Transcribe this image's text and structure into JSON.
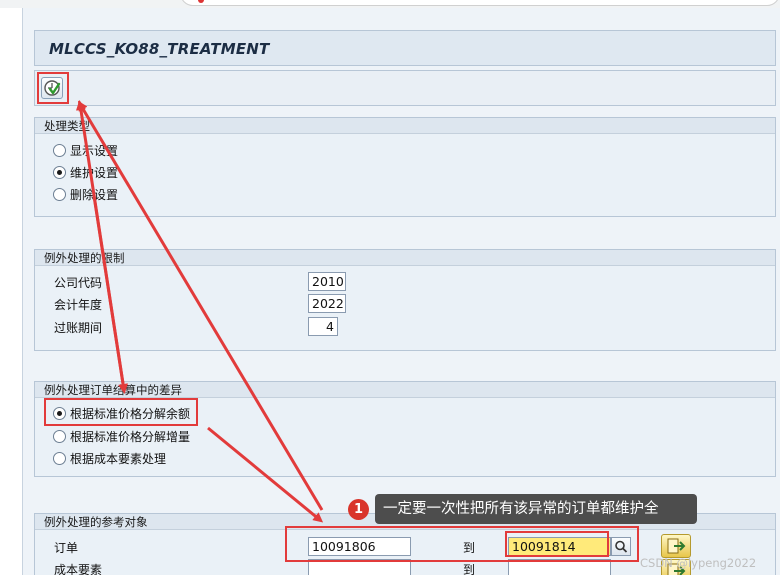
{
  "screen": {
    "title": "MLCCS_KO88_TREATMENT",
    "toolbar": {
      "execute_icon": "execute-clock-check-icon"
    },
    "groups": {
      "processing_type": {
        "title": "处理类型",
        "options": [
          {
            "label": "显示设置",
            "selected": false
          },
          {
            "label": "维护设置",
            "selected": true
          },
          {
            "label": "删除设置",
            "selected": false
          }
        ]
      },
      "restrictions": {
        "title": "例外处理的限制",
        "company_code_label": "公司代码",
        "company_code_value": "2010",
        "fiscal_year_label": "会计年度",
        "fiscal_year_value": "2022",
        "posting_period_label": "过账期间",
        "posting_period_value": "4"
      },
      "variance": {
        "title": "例外处理订单结算中的差异",
        "options": [
          {
            "label": "根据标准价格分解余额",
            "selected": true
          },
          {
            "label": "根据标准价格分解增量",
            "selected": false
          },
          {
            "label": "根据成本要素处理",
            "selected": false
          }
        ]
      },
      "reference": {
        "title": "例外处理的参考对象",
        "order_label": "订单",
        "order_from": "10091806",
        "to_label": "到",
        "order_to": "10091814",
        "cost_element_label": "成本要素",
        "cost_element_to_label": "到"
      }
    }
  },
  "annotation": {
    "badge": "1",
    "callout": "一定要一次性把所有该异常的订单都维护全",
    "color": "#e23b3b"
  },
  "watermark": "CSDN @lypeng2022",
  "colors": {
    "frame_bg": "#eef3f8",
    "group_header": "#dde6ef",
    "highlight_field": "#ffea7a",
    "annotation_red": "#e23b3b"
  }
}
